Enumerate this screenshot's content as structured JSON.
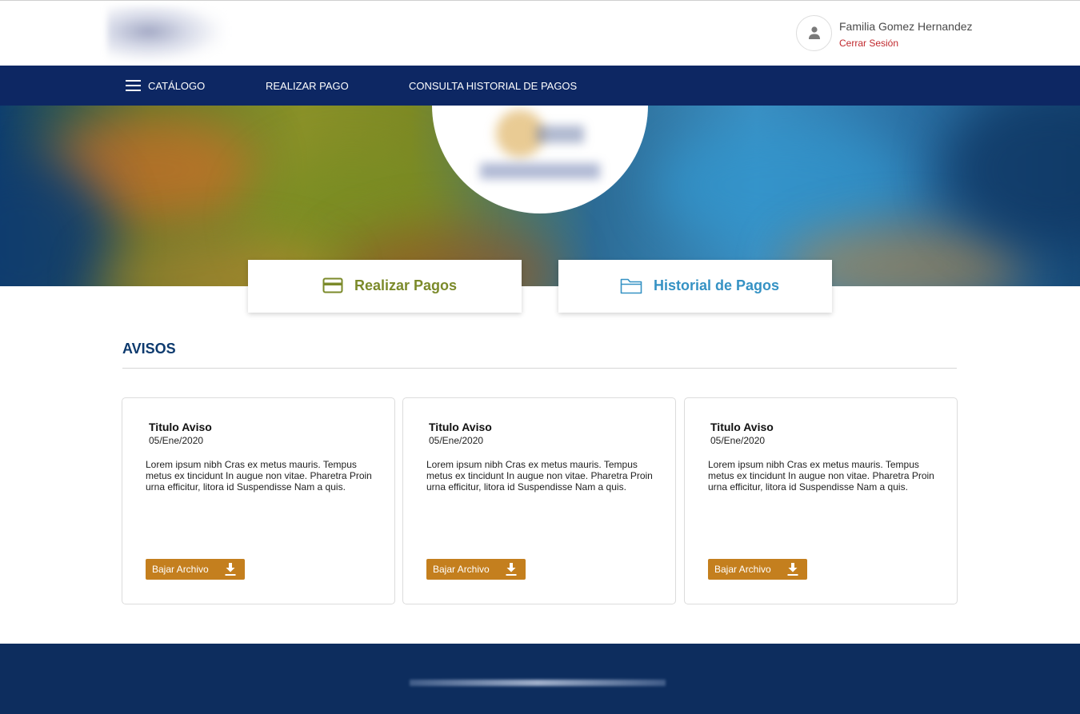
{
  "header": {
    "user_name": "Familia Gomez Hernandez",
    "logout_label": "Cerrar Sesión",
    "icons": {
      "logo": "school-logo",
      "avatar": "user-avatar-icon"
    }
  },
  "nav": {
    "items": [
      {
        "label": "CATÁLOGO",
        "icon": "menu-icon"
      },
      {
        "label": "REALIZAR PAGO"
      },
      {
        "label": "CONSULTA HISTORIAL DE PAGOS"
      }
    ]
  },
  "quick_actions": [
    {
      "label": "Realizar Pagos",
      "icon": "credit-card-icon",
      "color": "#7b8a2a"
    },
    {
      "label": "Historial de Pagos",
      "icon": "folder-icon",
      "color": "#3592c4"
    }
  ],
  "avisos": {
    "title": "AVISOS",
    "cards": [
      {
        "title": "Titulo Aviso",
        "date": "05/Ene/2020",
        "body": "Lorem ipsum nibh Cras ex metus mauris. Tempus metus ex tincidunt In augue non vitae. Pharetra Proin urna efficitur, litora id Suspendisse Nam a quis.",
        "button_label": "Bajar Archivo",
        "button_icon": "download-icon"
      },
      {
        "title": "Titulo Aviso",
        "date": "05/Ene/2020",
        "body": "Lorem ipsum nibh Cras ex metus mauris. Tempus metus ex tincidunt In augue non vitae. Pharetra Proin urna efficitur, litora id Suspendisse Nam a quis.",
        "button_label": "Bajar Archivo",
        "button_icon": "download-icon"
      },
      {
        "title": "Titulo Aviso",
        "date": "05/Ene/2020",
        "body": "Lorem ipsum nibh Cras ex metus mauris. Tempus metus ex tincidunt In augue non vitae. Pharetra Proin urna efficitur, litora id Suspendisse Nam a quis.",
        "button_label": "Bajar Archivo",
        "button_icon": "download-icon"
      }
    ]
  },
  "colors": {
    "nav_bg": "#0d2763",
    "footer_bg": "#0d2d5e",
    "accent_orange": "#c47f1e",
    "logout_red": "#c0282d",
    "section_title": "#0d3a6e"
  }
}
